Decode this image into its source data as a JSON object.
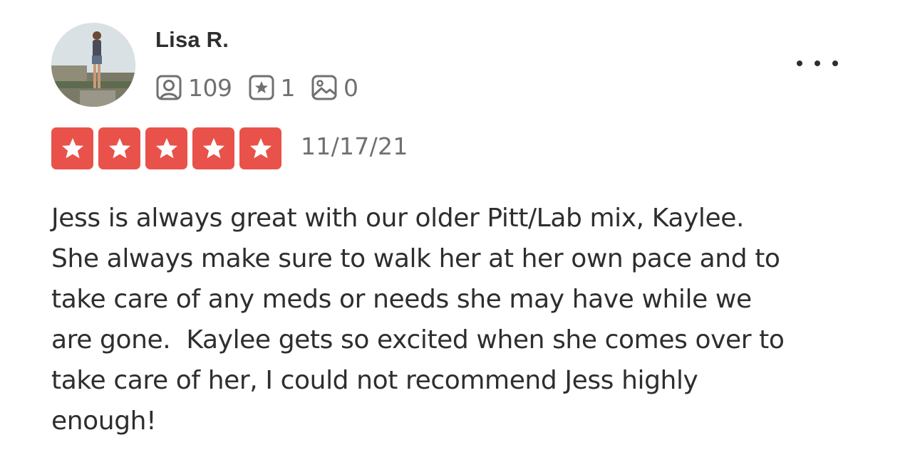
{
  "reviewer": {
    "name": "Lisa R.",
    "avatar_icon": "user-photo-avatar"
  },
  "stats": [
    {
      "icon": "friends-icon",
      "count": "109"
    },
    {
      "icon": "review-star-icon",
      "count": "1"
    },
    {
      "icon": "photo-icon",
      "count": "0"
    }
  ],
  "menu": {
    "icon": "more-options-icon"
  },
  "rating": {
    "value": 5,
    "max": 5,
    "color": "#e9524a"
  },
  "date": "11/17/21",
  "review_text": "Jess is always great with our older Pitt/Lab mix, Kaylee.\nShe always make sure to walk her at her own pace and to\ntake care of any meds or needs she may have while we\nare gone.  Kaylee gets so excited when she comes over to\ntake care of her, I could not recommend Jess highly\nenough!",
  "colors": {
    "text": "#2d2e2f",
    "muted": "#6e7072",
    "star_fill": "#e9524a"
  }
}
